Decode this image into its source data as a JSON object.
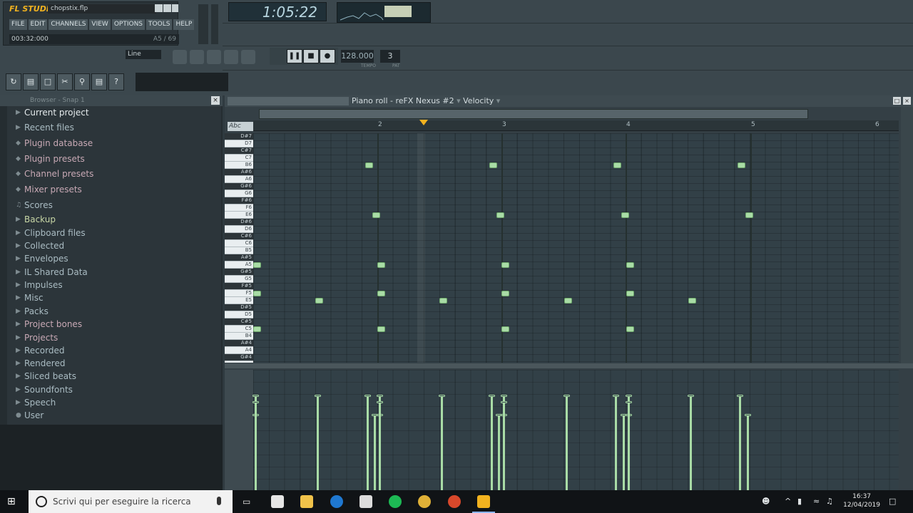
{
  "app": {
    "brand": "FL STUDIO",
    "file_name": "chopstix.flp",
    "menu": [
      "FILE",
      "EDIT",
      "CHANNELS",
      "VIEW",
      "OPTIONS",
      "TOOLS",
      "HELP"
    ],
    "hint_left": "003:32:000",
    "hint_right": "A5 / 69"
  },
  "transport": {
    "time_display": "1:05:22",
    "tempo": "128.000",
    "pattern": "3",
    "tempo_label": "TEMPO",
    "pattern_label": "PAT",
    "snap": "Line"
  },
  "browser": {
    "title": "Browser - Snap 1",
    "items": [
      {
        "label": "Current project",
        "icon": "folder-icon"
      },
      {
        "label": "Recent files",
        "icon": "folder-icon"
      },
      {
        "label": "Plugin database",
        "icon": "plugin-icon"
      },
      {
        "label": "Plugin presets",
        "icon": "plugin-icon"
      },
      {
        "label": "Channel presets",
        "icon": "plugin-icon"
      },
      {
        "label": "Mixer presets",
        "icon": "plugin-icon"
      },
      {
        "label": "Scores",
        "icon": "music-note-icon"
      },
      {
        "label": "Backup",
        "icon": "folder-icon"
      },
      {
        "label": "Clipboard files",
        "icon": "folder-icon"
      },
      {
        "label": "Collected",
        "icon": "folder-icon"
      },
      {
        "label": "Envelopes",
        "icon": "folder-icon"
      },
      {
        "label": "IL Shared Data",
        "icon": "folder-icon"
      },
      {
        "label": "Impulses",
        "icon": "folder-icon"
      },
      {
        "label": "Misc",
        "icon": "folder-icon"
      },
      {
        "label": "Packs",
        "icon": "folder-icon"
      },
      {
        "label": "Project bones",
        "icon": "folder-icon"
      },
      {
        "label": "Projects",
        "icon": "folder-icon"
      },
      {
        "label": "Recorded",
        "icon": "folder-icon"
      },
      {
        "label": "Rendered",
        "icon": "folder-icon"
      },
      {
        "label": "Sliced beats",
        "icon": "folder-icon"
      },
      {
        "label": "Soundfonts",
        "icon": "folder-icon"
      },
      {
        "label": "Speech",
        "icon": "folder-icon"
      },
      {
        "label": "User",
        "icon": "user-icon"
      }
    ]
  },
  "piano_roll": {
    "title": "Piano roll - reFX Nexus #2",
    "target": "Velocity",
    "key_label": "Abc",
    "bars": [
      "2",
      "3",
      "4",
      "5",
      "6"
    ],
    "keys": [
      "D#7",
      "D7",
      "C#7",
      "C7",
      "B6",
      "A#6",
      "A6",
      "G#6",
      "G6",
      "F#6",
      "F6",
      "E6",
      "D#6",
      "D6",
      "C#6",
      "C6",
      "B5",
      "A#5",
      "A5",
      "G#5",
      "G5",
      "F#5",
      "F5",
      "E5",
      "D#5",
      "D5",
      "C#5",
      "C5",
      "B4",
      "A#4",
      "A4",
      "G#4"
    ],
    "notes": [
      {
        "bar": 1.9,
        "pitch": "B6"
      },
      {
        "bar": 2.9,
        "pitch": "B6"
      },
      {
        "bar": 3.9,
        "pitch": "B6"
      },
      {
        "bar": 4.9,
        "pitch": "B6"
      },
      {
        "bar": 1.96,
        "pitch": "E6"
      },
      {
        "bar": 2.96,
        "pitch": "E6"
      },
      {
        "bar": 3.96,
        "pitch": "E6"
      },
      {
        "bar": 4.96,
        "pitch": "E6"
      },
      {
        "bar": 1.0,
        "pitch": "A5"
      },
      {
        "bar": 2.0,
        "pitch": "A5"
      },
      {
        "bar": 3.0,
        "pitch": "A5"
      },
      {
        "bar": 4.0,
        "pitch": "A5"
      },
      {
        "bar": 1.0,
        "pitch": "F5"
      },
      {
        "bar": 2.0,
        "pitch": "F5"
      },
      {
        "bar": 3.0,
        "pitch": "F5"
      },
      {
        "bar": 4.0,
        "pitch": "F5"
      },
      {
        "bar": 1.5,
        "pitch": "E5"
      },
      {
        "bar": 2.5,
        "pitch": "E5"
      },
      {
        "bar": 3.5,
        "pitch": "E5"
      },
      {
        "bar": 4.5,
        "pitch": "E5"
      },
      {
        "bar": 1.0,
        "pitch": "C5"
      },
      {
        "bar": 2.0,
        "pitch": "C5"
      },
      {
        "bar": 3.0,
        "pitch": "C5"
      },
      {
        "bar": 4.0,
        "pitch": "C5"
      }
    ]
  },
  "taskbar": {
    "search_placeholder": "Scrivi qui per eseguire la ricerca",
    "time": "16:37",
    "date": "12/04/2019"
  },
  "colors": {
    "note": "#a9dca6",
    "accent": "#f2b21f"
  }
}
